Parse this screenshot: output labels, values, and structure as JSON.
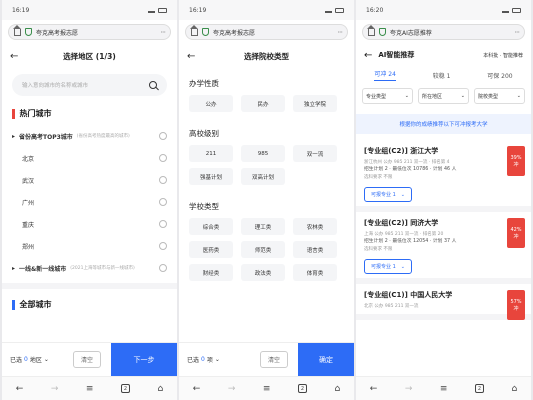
{
  "status": {
    "time": "16:19",
    "time2": "16:19",
    "time3": "16:20"
  },
  "browser": {
    "url": "夸克高考报志愿",
    "url3": "夸克AI志愿推荐"
  },
  "panel1": {
    "title": "选择地区 (1/3)",
    "search_placeholder": "输入意向城市的名称或城市",
    "hot_section": "热门城市",
    "rows": [
      {
        "label": "省份高考TOP3城市",
        "sub": "(省份高考热度最高的城市)",
        "bold": true
      },
      {
        "label": "北京",
        "sub": ""
      },
      {
        "label": "武汉",
        "sub": ""
      },
      {
        "label": "广州",
        "sub": ""
      },
      {
        "label": "重庆",
        "sub": ""
      },
      {
        "label": "郑州",
        "sub": ""
      },
      {
        "label": "一线&新一线城市",
        "sub": "(2021上海等城市与新一线城市)",
        "bold": true
      }
    ],
    "all_section": "全部城市",
    "footer": {
      "selected_prefix": "已选",
      "selected_count": "0",
      "selected_suffix": "地区",
      "clear": "清空",
      "next": "下一步"
    }
  },
  "panel2": {
    "title": "选择院校类型",
    "groups": [
      {
        "title": "办学性质",
        "chips": [
          "公办",
          "民办",
          "独立学院"
        ]
      },
      {
        "title": "高校级别",
        "chips": [
          "211",
          "985",
          "双一流",
          "强基计划",
          "双高计划"
        ]
      },
      {
        "title": "学校类型",
        "chips": [
          "综合类",
          "理工类",
          "农林类",
          "医药类",
          "师范类",
          "语言类",
          "财经类",
          "政法类",
          "体育类"
        ]
      }
    ],
    "footer": {
      "selected_prefix": "已选",
      "selected_count": "0",
      "selected_suffix": "项",
      "clear": "清空",
      "confirm": "确定"
    }
  },
  "panel3": {
    "title": "AI智能推荐",
    "right_label": "本科批 · 智能推荐",
    "tabs": [
      "可冲 24",
      "较稳 1",
      "可保 200"
    ],
    "filters": [
      "专业类型",
      "所在地区",
      "院校类型"
    ],
    "tip": "根据你的成绩推荐以下可冲报考大学",
    "cards": [
      {
        "name": "[专业组(C2)] 浙江大学",
        "meta": "浙江杭州 公办 985 211 双一流 · 排名第 4",
        "meta2": "招生计划 2 · 最低位次 10786 · 计划 46 人",
        "meta3": "选科要求 不限",
        "pct": "39%",
        "pct_label": "冲",
        "majors": "可报专业 1"
      },
      {
        "name": "[专业组(C2)] 同济大学",
        "meta": "上海 公办 985 211 双一流 · 排名第 20",
        "meta2": "招生计划 2 · 最低位次 12054 · 计划 37 人",
        "meta3": "选科要求 不限",
        "pct": "42%",
        "pct_label": "冲",
        "majors": "可报专业 1"
      },
      {
        "name": "[专业组(C1)] 中国人民大学",
        "meta": "北京 公办 985 211 双一流",
        "meta2": "",
        "meta3": "",
        "pct": "57%",
        "pct_label": "冲",
        "majors": ""
      }
    ]
  },
  "bottom_nav": {
    "back": "←",
    "forward": "→",
    "menu": "≡",
    "tabs": "2",
    "home": "⌂"
  }
}
